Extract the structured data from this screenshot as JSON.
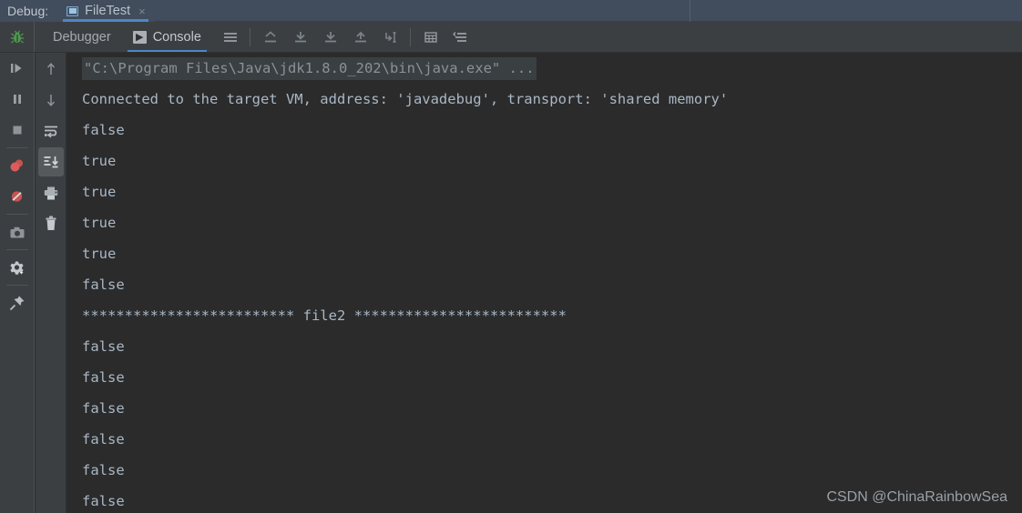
{
  "titlebar": {
    "label": "Debug:",
    "tab": {
      "title": "FileTest",
      "close": "×",
      "icon": "window-icon"
    }
  },
  "toolbar": {
    "bug_icon": "bug-icon",
    "tabs": [
      {
        "label": "Debugger",
        "active": false,
        "icon": null
      },
      {
        "label": "Console",
        "active": true,
        "icon": "console-play-icon",
        "icon_glyph": "▶"
      }
    ],
    "icons": [
      "hamburger-menu-icon",
      "separator",
      "export-up-icon",
      "download-icon",
      "download-alt-icon",
      "upload-icon",
      "wrap-cursor-icon",
      "separator",
      "grid-icon",
      "align-lines-icon"
    ]
  },
  "left_rail": {
    "items": [
      "resume-program-icon",
      "pause-program-icon",
      "stop-program-icon",
      "separator",
      "view-breakpoints-icon",
      "mute-breakpoints-icon",
      "separator",
      "camera-icon",
      "separator",
      "settings-gear-icon",
      "separator",
      "pin-icon"
    ]
  },
  "console_rail": {
    "items": [
      {
        "name": "scroll-up-icon",
        "active": false
      },
      {
        "name": "scroll-down-icon",
        "active": false
      },
      {
        "name": "soft-wrap-icon",
        "active": false
      },
      {
        "name": "scroll-to-end-icon",
        "active": true
      },
      {
        "name": "print-icon",
        "active": false
      },
      {
        "name": "clear-all-icon",
        "active": false
      }
    ]
  },
  "console": {
    "lines": [
      {
        "type": "cmd",
        "text": "\"C:\\Program Files\\Java\\jdk1.8.0_202\\bin\\java.exe\" ..."
      },
      {
        "type": "out",
        "text": "Connected to the target VM, address: 'javadebug', transport: 'shared memory'"
      },
      {
        "type": "out",
        "text": "false"
      },
      {
        "type": "out",
        "text": "true"
      },
      {
        "type": "out",
        "text": "true"
      },
      {
        "type": "out",
        "text": "true"
      },
      {
        "type": "out",
        "text": "true"
      },
      {
        "type": "out",
        "text": "false"
      },
      {
        "type": "stars",
        "text": "************************* file2 *************************"
      },
      {
        "type": "out",
        "text": "false"
      },
      {
        "type": "out",
        "text": "false"
      },
      {
        "type": "out",
        "text": "false"
      },
      {
        "type": "out",
        "text": "false"
      },
      {
        "type": "out",
        "text": "false"
      },
      {
        "type": "out",
        "text": "false"
      }
    ]
  },
  "watermark": {
    "text": "CSDN @ChinaRainbowSea"
  },
  "colors": {
    "titlebar_bg": "#414c5c",
    "toolbar_bg": "#3c3f41",
    "console_bg": "#2b2b2b",
    "accent_blue": "#4a88c7",
    "text_primary": "#a9b7c6",
    "text_muted": "#8a9199"
  }
}
